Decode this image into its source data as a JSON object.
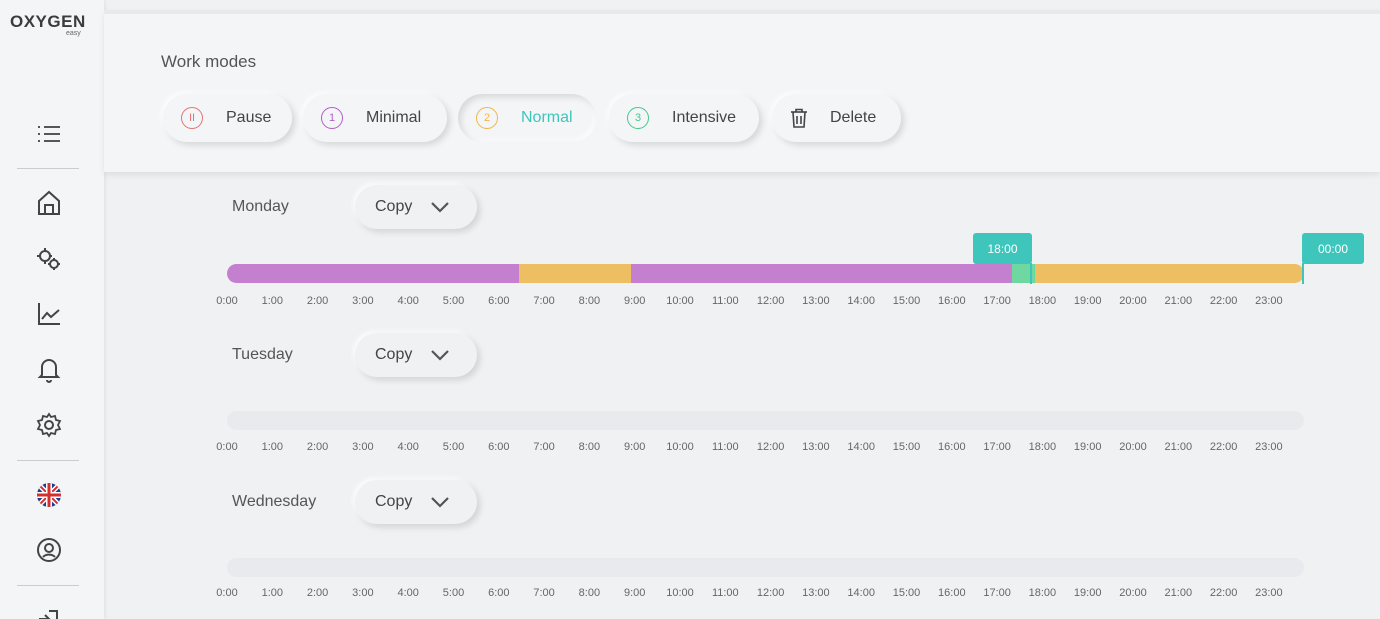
{
  "brand": {
    "name": "OXYGEN",
    "sub": "easy"
  },
  "sidebar": {
    "icons": [
      "menu-icon",
      "home-icon",
      "gears-icon",
      "chart-icon",
      "bell-icon",
      "settings-icon",
      "uk-flag-icon",
      "support-icon",
      "logout-icon"
    ]
  },
  "modes": {
    "title": "Work modes",
    "buttons": [
      {
        "label": "Pause",
        "glyph": "II",
        "color": "#e57373"
      },
      {
        "label": "Minimal",
        "glyph": "1",
        "color": "#b25ec9"
      },
      {
        "label": "Normal",
        "glyph": "2",
        "color": "#f0b54a",
        "active": true
      },
      {
        "label": "Intensive",
        "glyph": "3",
        "color": "#43c98a"
      },
      {
        "label": "Delete",
        "glyph": "trash",
        "color": "#555555"
      }
    ]
  },
  "colors": {
    "minimal": "#c47fcf",
    "normal": "#edbe62",
    "intensive": "#6fd7a0",
    "accent": "#3ec6bd",
    "normal_active_text": "#3ec6bd"
  },
  "hours": [
    "0:00",
    "1:00",
    "2:00",
    "3:00",
    "4:00",
    "5:00",
    "6:00",
    "7:00",
    "8:00",
    "9:00",
    "10:00",
    "11:00",
    "12:00",
    "13:00",
    "14:00",
    "15:00",
    "16:00",
    "17:00",
    "18:00",
    "19:00",
    "20:00",
    "21:00",
    "22:00",
    "23:00"
  ],
  "days": [
    {
      "name": "Monday",
      "copy": "Copy",
      "segments": [
        {
          "mode": "minimal",
          "start": 0,
          "end": 6.5
        },
        {
          "mode": "normal",
          "start": 6.5,
          "end": 9
        },
        {
          "mode": "minimal",
          "start": 9,
          "end": 17.5
        },
        {
          "mode": "intensive",
          "start": 17.5,
          "end": 18
        },
        {
          "mode": "normal",
          "start": 18,
          "end": 24
        }
      ],
      "markers": [
        {
          "label": "18:00",
          "time": 18
        },
        {
          "label": "00:00",
          "time": 24
        }
      ]
    },
    {
      "name": "Tuesday",
      "copy": "Copy",
      "segments": [],
      "markers": []
    },
    {
      "name": "Wednesday",
      "copy": "Copy",
      "segments": [],
      "markers": []
    }
  ]
}
